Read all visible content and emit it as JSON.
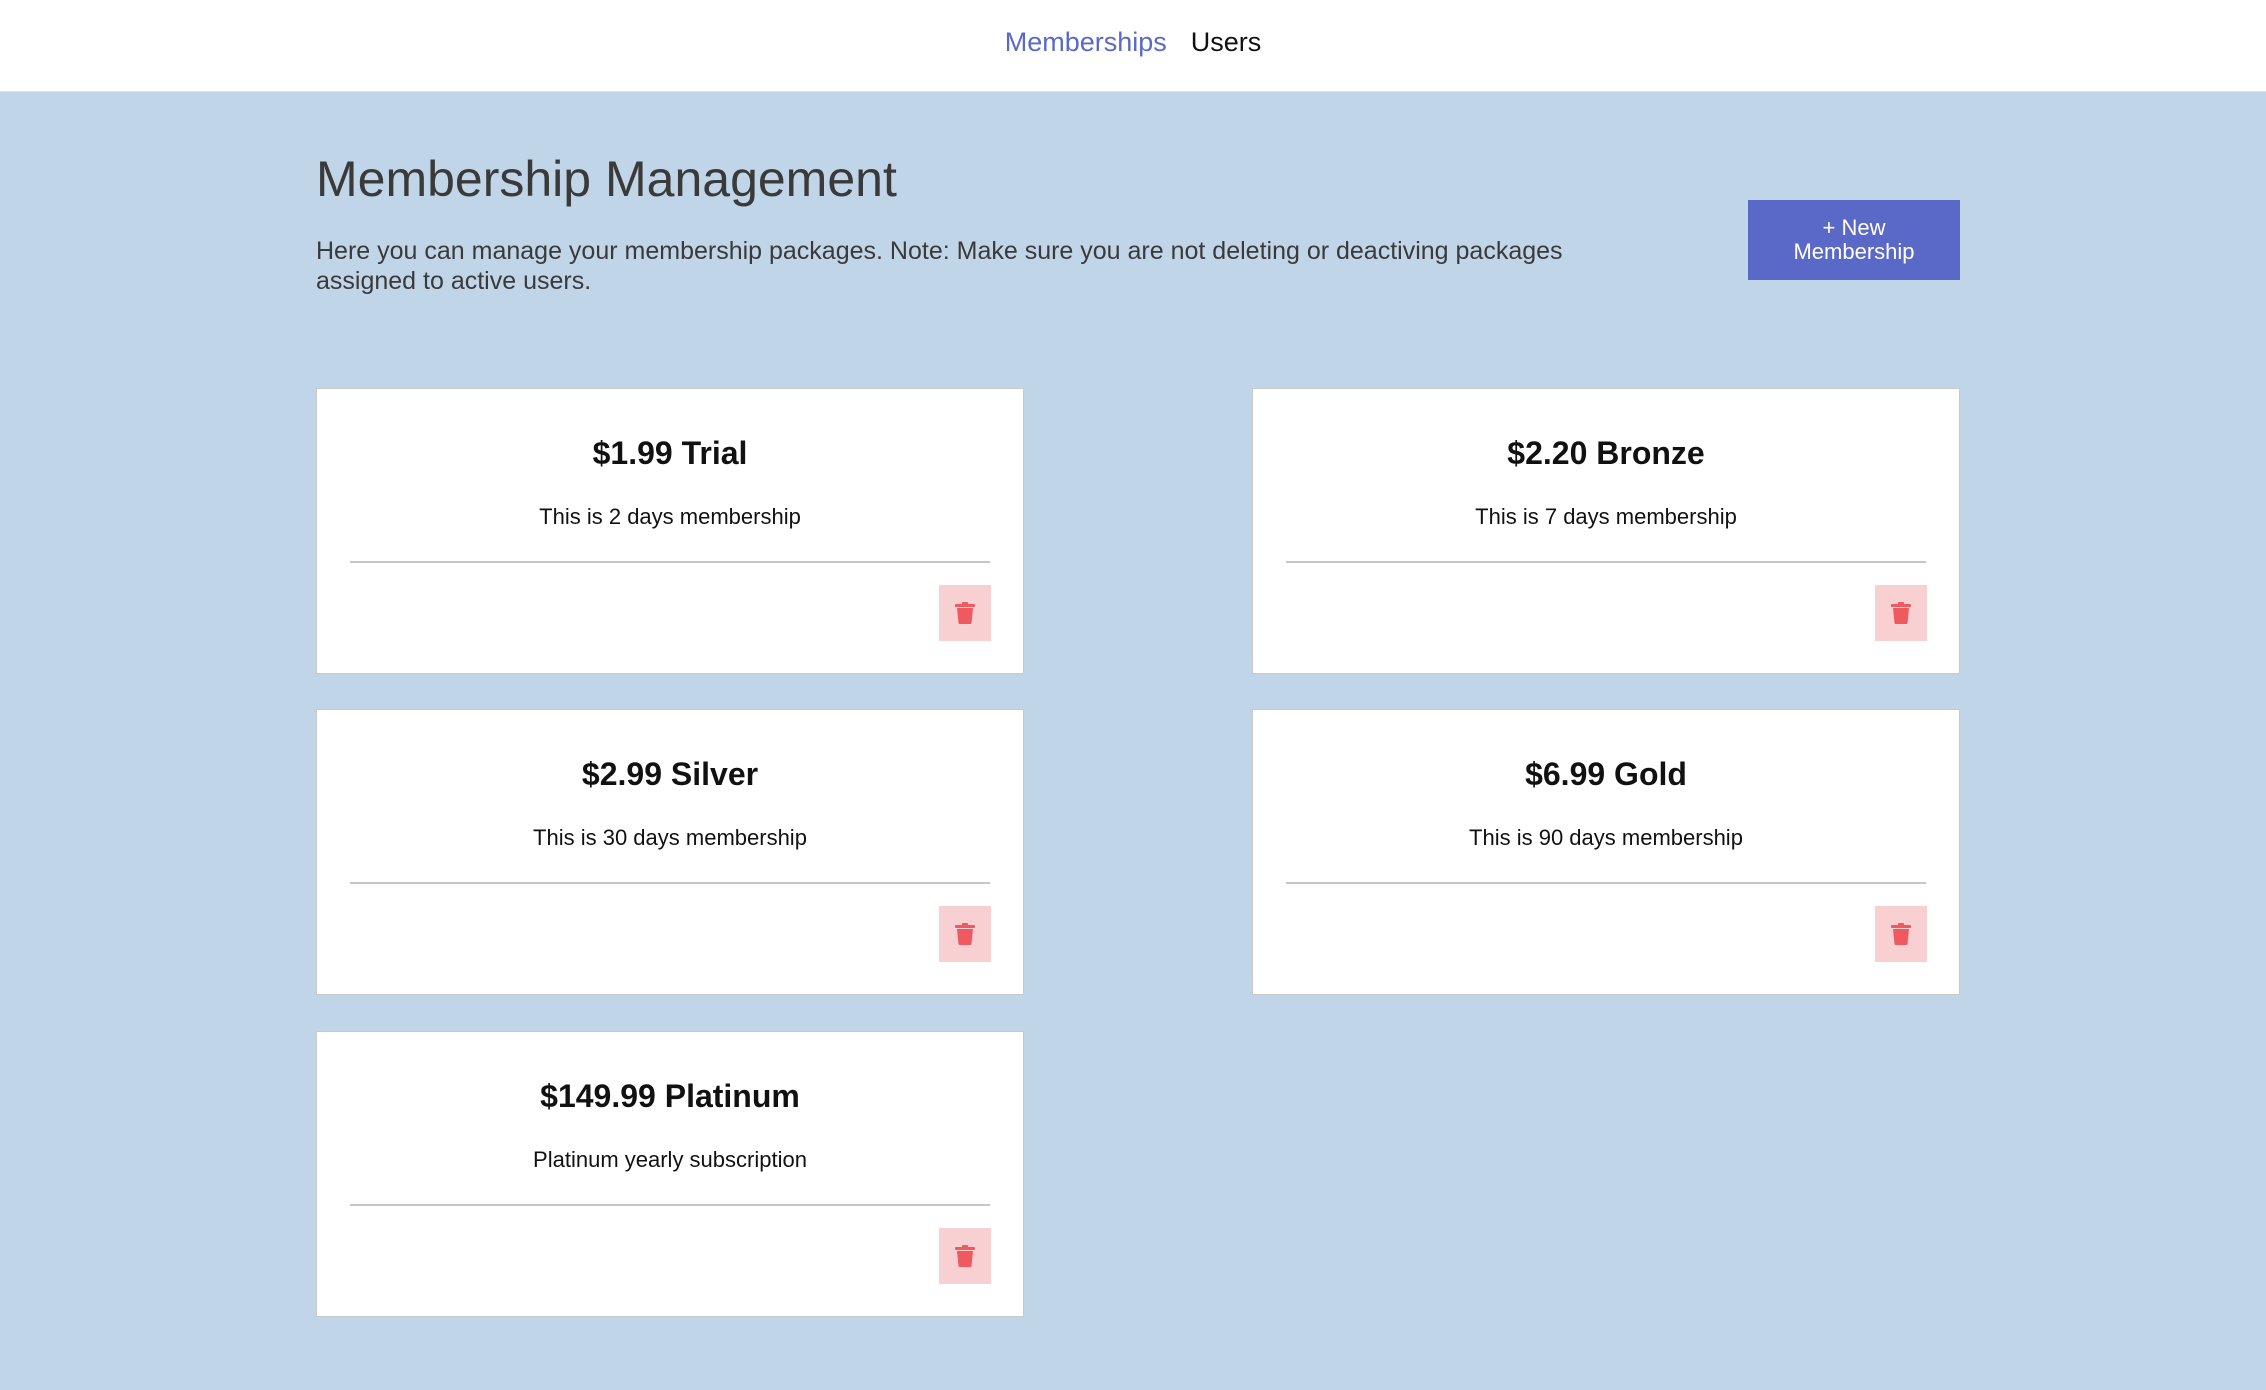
{
  "nav": {
    "items": [
      {
        "label": "Memberships",
        "active": true
      },
      {
        "label": "Users",
        "active": false
      }
    ]
  },
  "header": {
    "title": "Membership Management",
    "description": "Here you can manage your membership packages. Note: Make sure you are not deleting or deactiving packages assigned to active users.",
    "new_button_label": "+ New Membership"
  },
  "memberships": [
    {
      "title": "$1.99 Trial",
      "description": "This is 2 days membership"
    },
    {
      "title": "$2.20 Bronze",
      "description": "This is 7 days membership"
    },
    {
      "title": "$2.99 Silver",
      "description": "This is 30 days membership"
    },
    {
      "title": "$6.99 Gold",
      "description": "This is 90 days membership"
    },
    {
      "title": "$149.99 Platinum",
      "description": "Platinum yearly subscription"
    }
  ],
  "colors": {
    "accent": "#5a69c8",
    "background": "#c1d5e8",
    "delete_bg": "#f8d0d2",
    "delete_icon": "#ee5a60"
  },
  "icons": {
    "delete": "trash-icon"
  }
}
